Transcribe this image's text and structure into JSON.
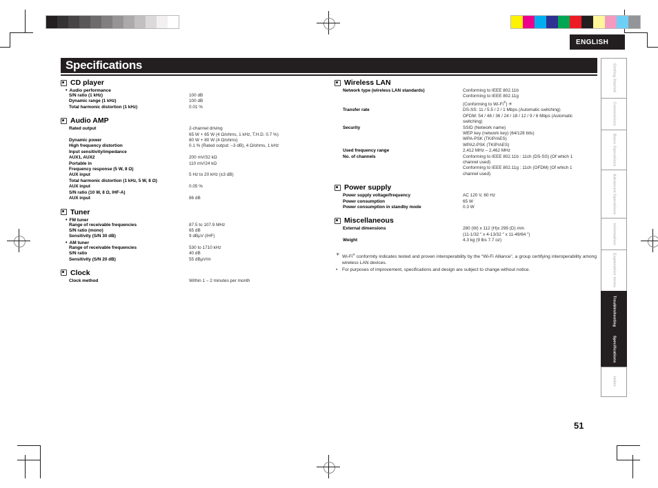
{
  "document": {
    "title": "Specifications",
    "language_tab": "ENGLISH",
    "page_number": "51"
  },
  "calibration": {
    "grayscale": [
      "#231f20",
      "#343233",
      "#474445",
      "#5a5758",
      "#6e6b6c",
      "#827f80",
      "#979495",
      "#adaaab",
      "#c3c0c1",
      "#dbd9da",
      "#f2f0f1",
      "#ffffff"
    ],
    "color": [
      "#fff200",
      "#ec008c",
      "#00aeef",
      "#2e3192",
      "#00a651",
      "#ed1c24",
      "#231f20",
      "#fff799",
      "#f49ac1",
      "#6dcff6",
      "#939598"
    ]
  },
  "left_column": [
    {
      "heading": "CD player",
      "subhead": "Audio performance",
      "rows": [
        {
          "key": "S/N ratio (1 kHz)",
          "values": [
            "100 dB"
          ]
        },
        {
          "key": "Dynamic range (1 kHz)",
          "values": [
            "100 dB"
          ]
        },
        {
          "key": "Total harmonic distortion (1 kHz)",
          "values": [
            "0.01 %"
          ]
        }
      ]
    },
    {
      "heading": "Audio AMP",
      "subhead": "",
      "rows": [
        {
          "key": "Rated output",
          "values": [
            "2-channel driving",
            "65 W + 65 W (4 Ω/ohms, 1 kHz, T.H.D. 0.7 %)"
          ]
        },
        {
          "key": "Dynamic power",
          "values": [
            "80 W + 80 W (4 Ω/ohms)"
          ]
        },
        {
          "key": "High frequency distortion",
          "values": [
            "0.1 % (Rated output: –3 dB), 4 Ω/ohms, 1 kHz"
          ]
        },
        {
          "key": "Input sensitivity/impedance",
          "values": [
            ""
          ]
        },
        {
          "key": "AUX1, AUX2",
          "values": [
            "200 mV/32 kΩ"
          ]
        },
        {
          "key": "Portable in",
          "values": [
            "110 mV/24 kΩ"
          ]
        },
        {
          "key": "Frequency response (5 W, 8 Ω)",
          "values": [
            ""
          ]
        },
        {
          "key": "AUX input",
          "values": [
            "5 Hz to 20 kHz (±3 dB)"
          ]
        },
        {
          "key": "Total harmonic distortion (1 kHz, 5 W, 8 Ω)",
          "values": [
            ""
          ]
        },
        {
          "key": "AUX input",
          "values": [
            "0.05 %"
          ]
        },
        {
          "key": "S/N ratio (10 W, 8 Ω, IHF-A)",
          "values": [
            ""
          ]
        },
        {
          "key": "AUX input",
          "values": [
            "86 dB"
          ]
        }
      ]
    },
    {
      "heading": "Tuner",
      "subhead": "FM tuner",
      "rows": [
        {
          "key": "Range of receivable frequencies",
          "values": [
            "87.5 to 107.9 MHz"
          ]
        },
        {
          "key": "S/N ratio (mono)",
          "values": [
            "65 dB"
          ]
        },
        {
          "key": "Sensitivity (S/N 30 dB)",
          "values": [
            "9 dBµV (IHF)"
          ]
        }
      ],
      "subhead2": "AM tuner",
      "rows2": [
        {
          "key": "Range of receivable frequencies",
          "values": [
            "530 to 1710 kHz"
          ]
        },
        {
          "key": "S/N ratio",
          "values": [
            "40 dB"
          ]
        },
        {
          "key": "Sensitivity (S/N 20 dB)",
          "values": [
            "55 dBµV/m"
          ]
        }
      ]
    },
    {
      "heading": "Clock",
      "subhead": "",
      "rows": [
        {
          "key": "Clock method",
          "values": [
            "Within 1 – 2 minutes per month"
          ]
        }
      ]
    }
  ],
  "right_column": [
    {
      "heading": "Wireless LAN",
      "subhead": "",
      "rows": [
        {
          "key": "Network type (wireless LAN standards)",
          "values": [
            "Conforming to IEEE 802.11b",
            "Conforming to IEEE 802.11g",
            "(Conforming to Wi-Fi®) ✳"
          ]
        },
        {
          "key": "Transfer rate",
          "values": [
            "DS-SS: 11 / 5.5 / 2 / 1 Mbps (Automatic switching)",
            "OFDM: 54 / 48 / 36 / 24 / 18 / 12 / 9 / 6 Mbps (Automatic",
            "switching)"
          ]
        },
        {
          "key": "Security",
          "values": [
            "SSID (Network name)",
            "WEP key (network key) (64/128 bits)",
            "WPA-PSK (TKIP/AES)",
            "WPA2-PSK (TKIP/AES)"
          ]
        },
        {
          "key": "Used frequency range",
          "values": [
            "2,412 MHz – 2,462 MHz"
          ]
        },
        {
          "key": "No. of channels",
          "values": [
            "Conforming to IEEE 802.11b : 11ch (DS-SS) (Of which 1",
            "channel used)",
            "Conforming to IEEE 802.11g : 11ch (OFDM) (Of which 1",
            "channel used)"
          ]
        }
      ]
    },
    {
      "heading": "Power supply",
      "subhead": "",
      "rows": [
        {
          "key": "Power supply voltage/frequency",
          "values": [
            "AC 120 V, 60 Hz"
          ]
        },
        {
          "key": "Power consumption",
          "values": [
            "65 W"
          ]
        },
        {
          "key": "Power consumption in standby mode",
          "values": [
            "0.3 W"
          ]
        }
      ]
    },
    {
      "heading": "Miscellaneous",
      "subhead": "",
      "rows": [
        {
          "key": "External dimensions",
          "values": [
            "280 (W) x 112 (H)x 299 (D) mm",
            "(11-1/32 ″ x 4-13/32 ″ x  11-49/64 ″)"
          ]
        },
        {
          "key": "Weight",
          "values": [
            "4.3 kg (9 lbs 7.7 oz)"
          ]
        }
      ]
    }
  ],
  "notes": [
    {
      "marker": "✳",
      "text_parts": [
        "Wi-Fi",
        "®",
        " conformity indicates tested and proven interoperability by the “Wi-Fi Alliance”, a group certifying interoperability among wireless LAN devices."
      ],
      "text": "Wi-Fi® conformity indicates tested and proven interoperability by the “Wi-Fi Alliance”, a group certifying interoperability among wireless LAN devices."
    },
    {
      "marker": "•",
      "text": "For purposes of improvement, specifications and design are subject to change without notice."
    }
  ],
  "side_tabs": [
    {
      "label": "Getting Started",
      "active": false,
      "height": 58
    },
    {
      "label": "Connections",
      "active": false,
      "height": 46
    },
    {
      "label": "Basic Operations",
      "active": false,
      "height": 58
    },
    {
      "label": "Advanced Operations",
      "active": false,
      "height": 70
    },
    {
      "label": "Information",
      "active": false,
      "height": 46
    },
    {
      "label": "Explanation terms",
      "active": false,
      "height": 60
    },
    {
      "label": "Troubleshooting",
      "active": true,
      "height": 58
    },
    {
      "label": "Specifications",
      "active": true,
      "height": 52
    },
    {
      "label": "Index",
      "active": false,
      "height": 44
    }
  ]
}
